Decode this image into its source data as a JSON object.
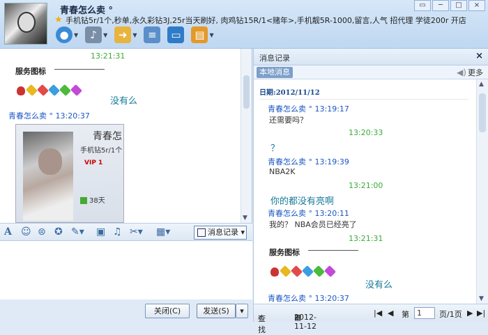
{
  "titlebar": {
    "nickname": "青春怎么卖 °",
    "signature": "手机钻5r/1个,秒单,永久彩钻3J,25r当天刷好, 肉鸡钻15R/1<赌年>,手机靓5R-1000,留言,人气 招代理  学徒200r 开店",
    "window_buttons": [
      "▭",
      "─",
      "□",
      "×"
    ]
  },
  "chat": {
    "time1": "13:21:31",
    "sticker_title": "服务图标",
    "sticker_caption": "没有么",
    "sender": "青春怎么卖 °",
    "send_time": "13:20:37",
    "card_name": "青春怎",
    "card_desc": "手机钻5r/1个",
    "card_vip": "VIP 1",
    "card_days": "38天"
  },
  "input": {
    "history_label": "消息记录",
    "close_label": "关闭(C)",
    "send_label": "发送(S)"
  },
  "history": {
    "title": "消息记录",
    "tab_local": "本地消息",
    "more": "更多",
    "date": "日期:2012/11/12",
    "entries": [
      {
        "name": "青春怎么卖 °",
        "time": "13:19:17",
        "text": "还需要吗？"
      },
      {
        "time": "13:20:33",
        "text": "？"
      },
      {
        "name": "青春怎么卖 °",
        "time": "13:19:39",
        "text": "NBA2K"
      },
      {
        "time": "13:21:00",
        "text": "你的都没有亮啊"
      },
      {
        "name": "青春怎么卖 °",
        "time": "13:20:11",
        "text": "我的？ NBA会员已经亮了"
      },
      {
        "time": "13:21:31",
        "text": "没有么"
      },
      {
        "name": "青春怎么卖 °",
        "time": "13:20:37"
      }
    ],
    "sticker_title": "服务图标",
    "footer": {
      "search": "查找",
      "date": "2012-11-12",
      "page_prefix": "第",
      "page": "1",
      "page_total": "页/1页"
    }
  },
  "colors": {
    "accent": "#1a56c4",
    "green_time": "#3aaa3a",
    "caption": "#167a9a"
  }
}
